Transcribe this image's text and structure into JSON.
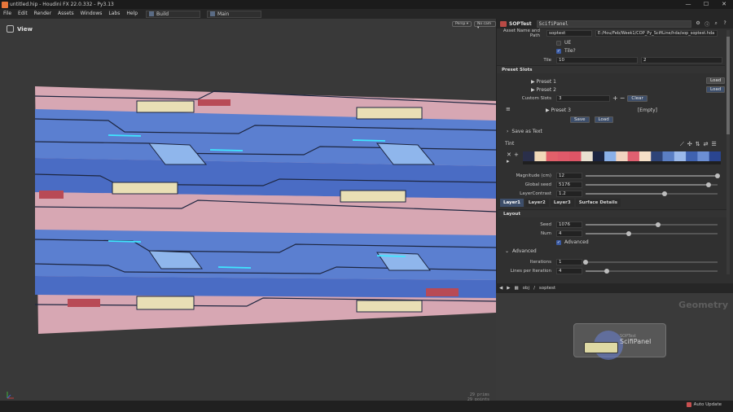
{
  "window": {
    "title": "untitled.hip - Houdini FX 22.0.332 - Py3.13",
    "min": "—",
    "max": "☐",
    "close": "✕"
  },
  "menu": {
    "items": [
      "File",
      "Edit",
      "Render",
      "Assets",
      "Windows",
      "Labs",
      "Help"
    ],
    "desktop": "Build",
    "pane": "Main"
  },
  "viewport": {
    "title": "View",
    "persp": "Persp ▾",
    "cam": "No cam ▾",
    "stats": [
      "29 prims",
      "29 points"
    ]
  },
  "param_header": {
    "node_type": "SOPTest",
    "node_name": "ScifiPanel"
  },
  "asset": {
    "label": "Asset Name and Path",
    "name": "soptest",
    "path": "E:/Hou/Feb/Week1/COP_Py_ScifiLine/hda/sop_soptest.hda"
  },
  "uv_label": "UE",
  "tile": {
    "toggle_label": "Tile?",
    "label": "Tile",
    "x": "10",
    "y": "2"
  },
  "preset_slots": {
    "title": "Preset Slots",
    "preset1": "▶ Preset 1",
    "preset2": "▶ Preset 2",
    "load": "Load",
    "custom_label": "Custom Slots",
    "custom_value": "3",
    "clear": "Clear",
    "preset3": "▶ Preset 3",
    "preset3_value": "[Empty]",
    "save": "Save",
    "load2": "Load"
  },
  "save_as_text": "Save as Text",
  "tint": {
    "label": "Tint",
    "colors": [
      "#2a2f4a",
      "#f0d8b8",
      "#e2606a",
      "#e05a6a",
      "#dd5566",
      "#e8e0d0",
      "#1b2440",
      "#8ab0e8",
      "#f2d4c0",
      "#e06070",
      "#f6e0c8",
      "#2e4478",
      "#5b7fc4",
      "#9bb9ea",
      "#3f62b0",
      "#6c8fd4",
      "#2a4590"
    ]
  },
  "magnitude": {
    "label": "Magnitude (cm)",
    "value": "12",
    "level": 1.0
  },
  "global_seed": {
    "label": "Global seed",
    "value": "5176",
    "level": 0.93
  },
  "layer_contrast": {
    "label": "LayerContrast",
    "value": "1.2",
    "level": 0.6
  },
  "tabs": [
    "Layer1",
    "Layer2",
    "Layer3",
    "Surface Details"
  ],
  "layout": {
    "title": "Layout",
    "seed_label": "Seed",
    "seed": "1076",
    "seed_level": 0.55,
    "num_label": "Num",
    "num": "4",
    "num_level": 0.33,
    "advanced_toggle": "Advanced"
  },
  "advanced": {
    "title": "Advanced",
    "iterations_label": "Iterations",
    "iterations": "1",
    "iterations_level": 0.0,
    "lines_label": "Lines per Iteration",
    "lines": "4",
    "lines_level": 0.16
  },
  "network": {
    "path": [
      "obj",
      "soptest"
    ],
    "context": "Geometry",
    "node_name": "ScifiPanel",
    "node_type": "SOPTest"
  },
  "status": {
    "auto_update": "Auto Update"
  }
}
